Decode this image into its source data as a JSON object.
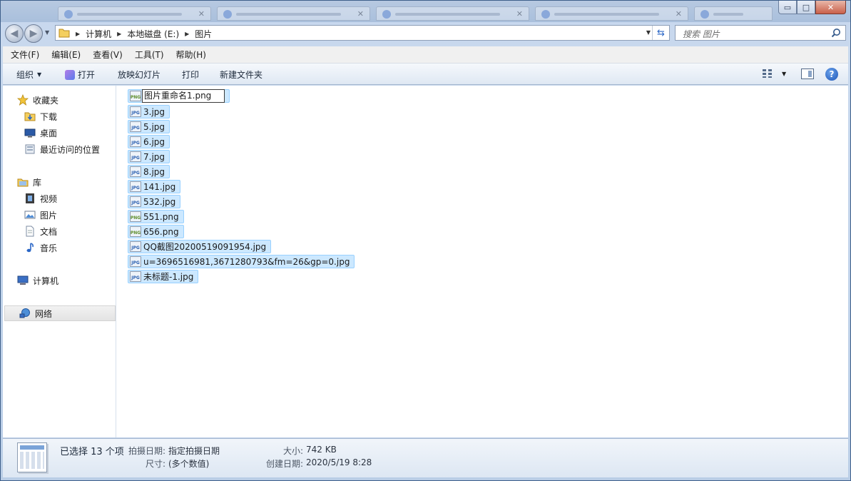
{
  "window": {
    "controls": {
      "minimize": "▭",
      "maximize": "□",
      "close": "✕"
    }
  },
  "address": {
    "crumbs": [
      "计算机",
      "本地磁盘 (E:)",
      "图片"
    ]
  },
  "search": {
    "placeholder": "搜索 图片"
  },
  "menubar": {
    "items": [
      "文件(F)",
      "编辑(E)",
      "查看(V)",
      "工具(T)",
      "帮助(H)"
    ]
  },
  "commandbar": {
    "organize": "组织",
    "open": "打开",
    "slideshow": "放映幻灯片",
    "print": "打印",
    "new_folder": "新建文件夹"
  },
  "navpane": {
    "favorites": "收藏夹",
    "downloads": "下载",
    "desktop": "桌面",
    "recent": "最近访问的位置",
    "libraries": "库",
    "videos": "视频",
    "pictures": "图片",
    "documents": "文档",
    "music": "音乐",
    "computer": "计算机",
    "network": "网络"
  },
  "files": [
    {
      "name": "图片重命名1.png",
      "type": "png",
      "renaming": true
    },
    {
      "name": "3.jpg",
      "type": "jpg"
    },
    {
      "name": "5.jpg",
      "type": "jpg"
    },
    {
      "name": "6.jpg",
      "type": "jpg"
    },
    {
      "name": "7.jpg",
      "type": "jpg"
    },
    {
      "name": "8.jpg",
      "type": "jpg"
    },
    {
      "name": "141.jpg",
      "type": "jpg"
    },
    {
      "name": "532.jpg",
      "type": "jpg"
    },
    {
      "name": "551.png",
      "type": "png"
    },
    {
      "name": "656.png",
      "type": "png"
    },
    {
      "name": "QQ截图20200519091954.jpg",
      "type": "jpg"
    },
    {
      "name": "u=3696516981,3671280793&fm=26&gp=0.jpg",
      "type": "jpg"
    },
    {
      "name": "未标题-1.jpg",
      "type": "jpg"
    }
  ],
  "status": {
    "selected": "已选择 13 个项",
    "date_taken_label": "拍摄日期:",
    "date_taken_value": "指定拍摄日期",
    "dimensions_label": "尺寸:",
    "dimensions_value": "(多个数值)",
    "size_label": "大小:",
    "size_value": "742 KB",
    "created_label": "创建日期:",
    "created_value": "2020/5/19 8:28"
  },
  "colors": {
    "selection": "#cce8ff",
    "selection_border": "#99d1ff",
    "accent": "#1e56b8"
  }
}
